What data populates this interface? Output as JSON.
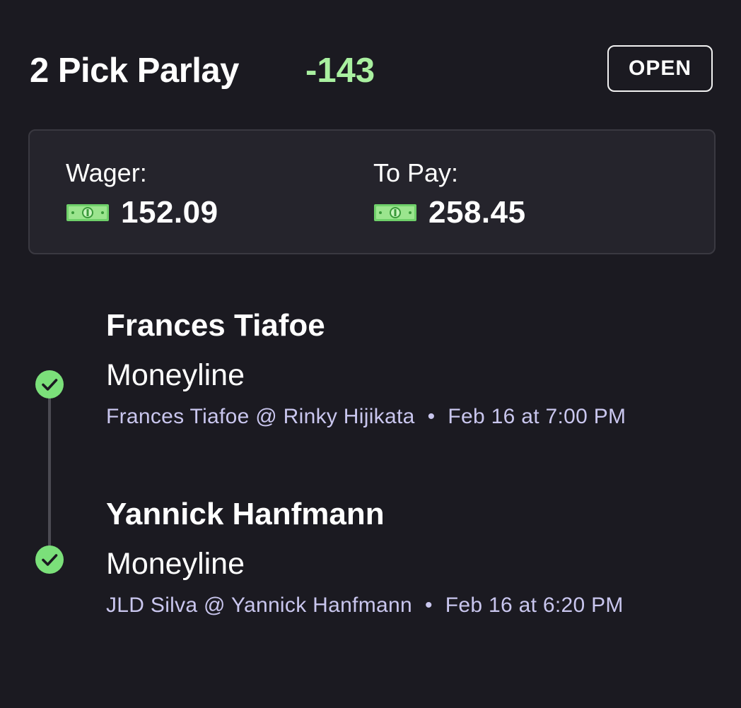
{
  "header": {
    "title": "2 Pick Parlay",
    "odds": "-143",
    "status": "OPEN"
  },
  "summary": {
    "wager_label": "Wager:",
    "wager_value": "152.09",
    "topay_label": "To Pay:",
    "topay_value": "258.45",
    "currency_icon": "cash-icon"
  },
  "legs": [
    {
      "player": "Frances Tiafoe",
      "market": "Moneyline",
      "matchup": "Frances Tiafoe @ Rinky Hijikata",
      "separator": "•",
      "time": "Feb 16 at 7:00 PM",
      "status_icon": "check-circle-icon"
    },
    {
      "player": "Yannick Hanfmann",
      "market": "Moneyline",
      "matchup": "JLD Silva @ Yannick Hanfmann",
      "separator": "•",
      "time": "Feb 16 at 6:20 PM",
      "status_icon": "check-circle-icon"
    }
  ],
  "colors": {
    "background": "#1b1a21",
    "card": "#25242c",
    "accent_green": "#a9f0a0",
    "check_green": "#7be07a",
    "detail_text": "#c9c6ee"
  }
}
